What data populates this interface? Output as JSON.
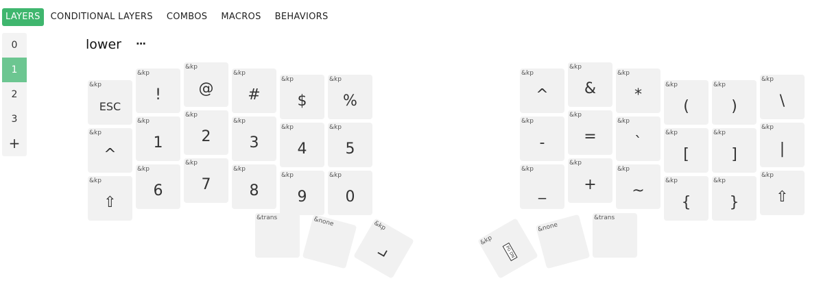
{
  "nav": [
    "LAYERS",
    "CONDITIONAL LAYERS",
    "COMBOS",
    "MACROS",
    "BEHAVIORS"
  ],
  "layers": [
    "0",
    "1",
    "2",
    "3"
  ],
  "layer_add": "+",
  "layer_name": "lower",
  "layer_menu": "···",
  "keys": [
    {
      "bind": "&kp",
      "legend": "ESC"
    },
    {
      "bind": "&kp",
      "legend": "!"
    },
    {
      "bind": "&kp",
      "legend": "@"
    },
    {
      "bind": "&kp",
      "legend": "#"
    },
    {
      "bind": "&kp",
      "legend": "$"
    },
    {
      "bind": "&kp",
      "legend": "%"
    },
    {
      "bind": "&kp",
      "legend": "^"
    },
    {
      "bind": "&kp",
      "legend": "&"
    },
    {
      "bind": "&kp",
      "legend": "*"
    },
    {
      "bind": "&kp",
      "legend": "("
    },
    {
      "bind": "&kp",
      "legend": ")"
    },
    {
      "bind": "&kp",
      "legend": "\\"
    },
    {
      "bind": "&kp",
      "legend": "^"
    },
    {
      "bind": "&kp",
      "legend": "1"
    },
    {
      "bind": "&kp",
      "legend": "2"
    },
    {
      "bind": "&kp",
      "legend": "3"
    },
    {
      "bind": "&kp",
      "legend": "4"
    },
    {
      "bind": "&kp",
      "legend": "5"
    },
    {
      "bind": "&kp",
      "legend": "-"
    },
    {
      "bind": "&kp",
      "legend": "="
    },
    {
      "bind": "&kp",
      "legend": "`"
    },
    {
      "bind": "&kp",
      "legend": "["
    },
    {
      "bind": "&kp",
      "legend": "]"
    },
    {
      "bind": "&kp",
      "legend": "|"
    },
    {
      "bind": "&kp",
      "legend": "⇧"
    },
    {
      "bind": "&kp",
      "legend": "6"
    },
    {
      "bind": "&kp",
      "legend": "7"
    },
    {
      "bind": "&kp",
      "legend": "8"
    },
    {
      "bind": "&kp",
      "legend": "9"
    },
    {
      "bind": "&kp",
      "legend": "0"
    },
    {
      "bind": "&kp",
      "legend": "_"
    },
    {
      "bind": "&kp",
      "legend": "+"
    },
    {
      "bind": "&kp",
      "legend": "~"
    },
    {
      "bind": "&kp",
      "legend": "{"
    },
    {
      "bind": "&kp",
      "legend": "}"
    },
    {
      "bind": "&kp",
      "legend": "⇧"
    },
    {
      "bind": "&trans",
      "legend": ""
    },
    {
      "bind": "&none",
      "legend": ""
    },
    {
      "bind": "&kp",
      "legend": "enter-icon"
    },
    {
      "bind": "&kp",
      "legend": "PG DN"
    },
    {
      "bind": "&none",
      "legend": ""
    },
    {
      "bind": "&trans",
      "legend": ""
    }
  ]
}
